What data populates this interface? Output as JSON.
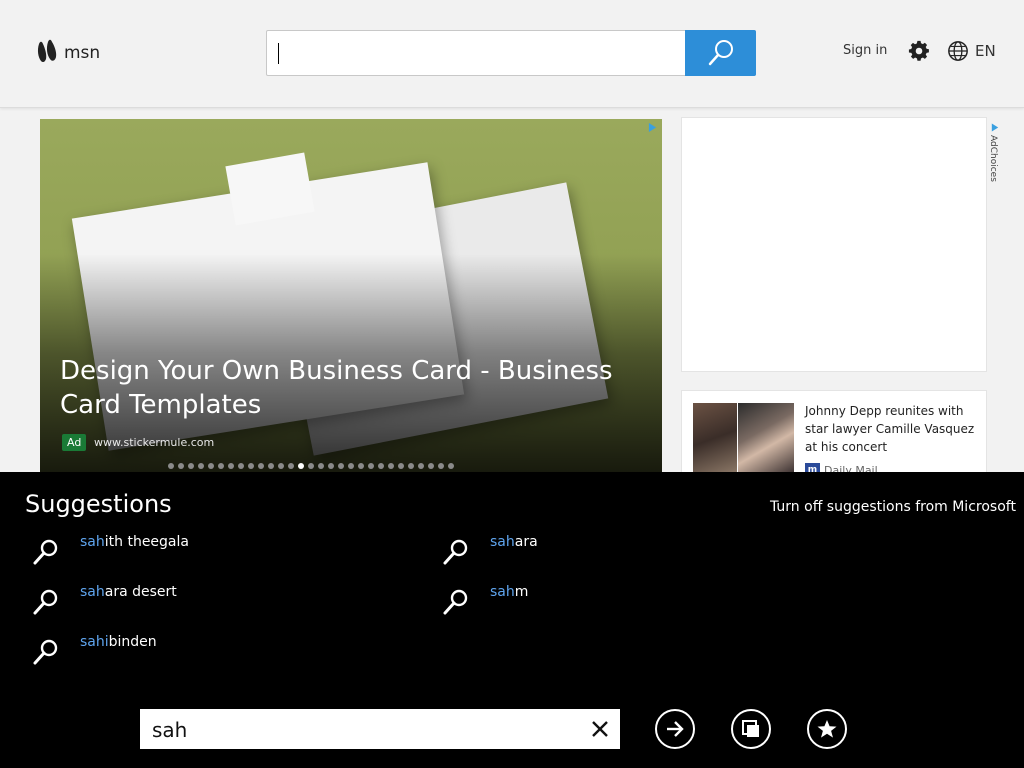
{
  "header": {
    "logo_text": "msn",
    "search_placeholder": "",
    "sign_in": "Sign in",
    "language": "EN",
    "search_button_color": "#2d8ed8"
  },
  "hero": {
    "title": "Design Your Own Business Card - Business Card Templates",
    "ad_badge": "Ad",
    "ad_url": "www.stickermule.com",
    "carousel_total": 29,
    "carousel_active": 13
  },
  "right_column": {
    "adchoices": "AdChoices",
    "news": {
      "title": "Johnny Depp reunites with star lawyer Camille Vasquez at his concert",
      "source_icon": "m",
      "source": "Daily Mail"
    }
  },
  "suggestions": {
    "title": "Suggestions",
    "turn_off": "Turn off suggestions from Microsoft",
    "highlight_color": "#5fa5ef",
    "items": [
      {
        "match": "sah",
        "rest": "ith theegala"
      },
      {
        "match": "sah",
        "rest": "ara desert"
      },
      {
        "match": "sahi",
        "rest": "binden"
      },
      {
        "match": "sah",
        "rest": "ara"
      },
      {
        "match": "sah",
        "rest": "m"
      }
    ],
    "query": "sah",
    "icons": [
      "clear-icon",
      "go-arrow-icon",
      "tabs-icon",
      "favorite-star-icon"
    ]
  }
}
